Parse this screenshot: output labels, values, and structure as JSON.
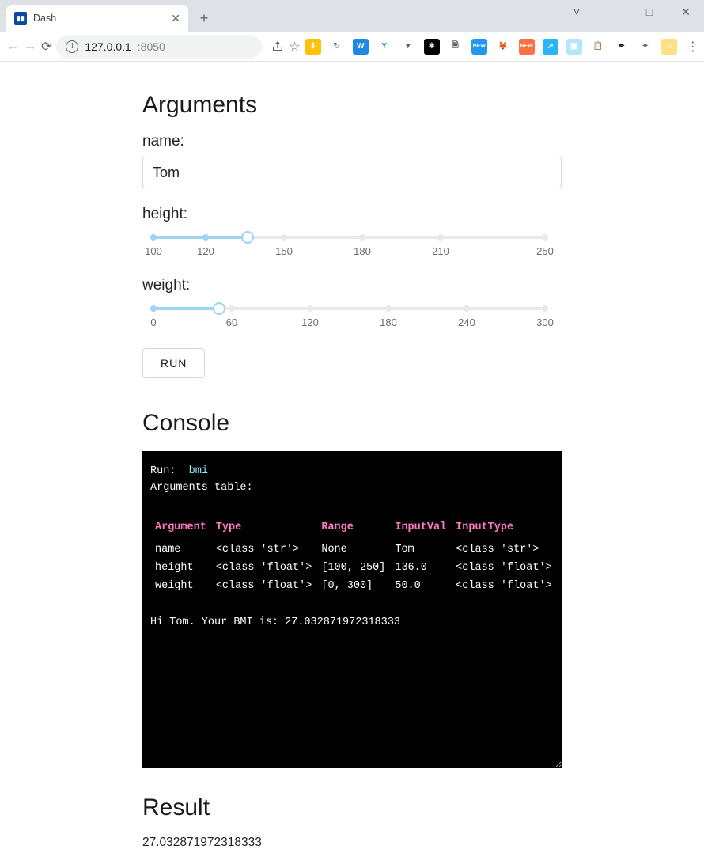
{
  "browser": {
    "tab_title": "Dash",
    "url_host": "127.0.0.1",
    "url_port": ":8050",
    "window_controls": {
      "caret": "˅",
      "min": "—",
      "max": "□",
      "close": "✕"
    }
  },
  "extensions": [
    {
      "name": "download",
      "bg": "#ffc107",
      "glyph": "⬇"
    },
    {
      "name": "sync",
      "bg": "transparent",
      "glyph": "↻",
      "fg": "#5f6368"
    },
    {
      "name": "wps",
      "bg": "#1e88e5",
      "glyph": "W"
    },
    {
      "name": "vue",
      "bg": "transparent",
      "glyph": "Y",
      "fg": "#1e88e5"
    },
    {
      "name": "dropdown",
      "bg": "transparent",
      "glyph": "▾",
      "fg": "#5f6368"
    },
    {
      "name": "react",
      "bg": "#000",
      "glyph": "⚛"
    },
    {
      "name": "doc",
      "bg": "transparent",
      "glyph": "🗎",
      "fg": "#5f6368"
    },
    {
      "name": "new1",
      "bg": "#2196f3",
      "glyph": "NEW"
    },
    {
      "name": "firefox",
      "bg": "transparent",
      "glyph": "🦊"
    },
    {
      "name": "new2",
      "bg": "#ff7043",
      "glyph": "NEW"
    },
    {
      "name": "share",
      "bg": "#29b6f6",
      "glyph": "↗"
    },
    {
      "name": "img",
      "bg": "#b3e5fc",
      "glyph": "▦"
    },
    {
      "name": "clip",
      "bg": "transparent",
      "glyph": "📋"
    },
    {
      "name": "picker",
      "bg": "transparent",
      "glyph": "✒",
      "fg": "#222"
    },
    {
      "name": "puzzle",
      "bg": "transparent",
      "glyph": "✦",
      "fg": "#5f6368"
    },
    {
      "name": "avatar",
      "bg": "#ffe082",
      "glyph": "☺"
    }
  ],
  "page": {
    "headings": {
      "arguments": "Arguments",
      "console": "Console",
      "result": "Result"
    },
    "labels": {
      "name": "name:",
      "height": "height:",
      "weight": "weight:"
    },
    "name_value": "Tom",
    "height": {
      "min": 100,
      "max": 250,
      "value": 136,
      "ticks": [
        100,
        120,
        150,
        180,
        210,
        250
      ]
    },
    "weight": {
      "min": 0,
      "max": 300,
      "value": 50,
      "ticks": [
        0,
        60,
        120,
        180,
        240,
        300
      ]
    },
    "run_label": "RUN"
  },
  "console": {
    "run_label": "Run:",
    "run_target": "bmi",
    "args_table_label": "Arguments table:",
    "headers": [
      "Argument",
      "Type",
      "Range",
      "InputVal",
      "InputType"
    ],
    "rows": [
      {
        "arg": "name",
        "type": "<class 'str'>",
        "range": "None",
        "inputval": "Tom",
        "inputtype": "<class 'str'>"
      },
      {
        "arg": "height",
        "type": "<class 'float'>",
        "range": "[100, 250]",
        "inputval": "136.0",
        "inputtype": "<class 'float'>"
      },
      {
        "arg": "weight",
        "type": "<class 'float'>",
        "range": "[0, 300]",
        "inputval": "50.0",
        "inputtype": "<class 'float'>"
      }
    ],
    "output_line": "Hi Tom. Your BMI is: 27.032871972318333"
  },
  "result": {
    "value": "27.032871972318333"
  }
}
